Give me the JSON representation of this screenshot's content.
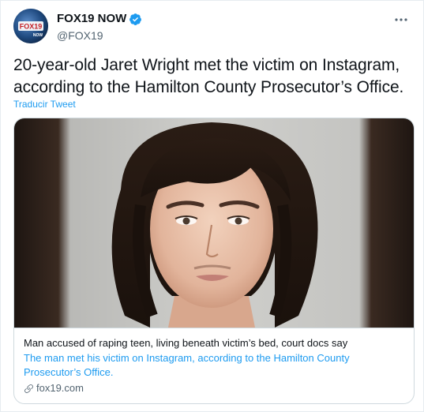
{
  "account": {
    "display_name": "FOX19 NOW",
    "handle": "@FOX19",
    "avatar_logo_text": "FOX19",
    "avatar_logo_subtext": "NOW",
    "verified": true,
    "avatar_icon": "fox19-logo-icon",
    "verified_icon": "verified-badge-icon",
    "more_icon": "more-dots-icon"
  },
  "tweet": {
    "text": "20-year-old Jaret Wright met the victim on Instagram, according to the Hamilton County Prosecutor’s Office.",
    "translate_label": "Traducir Tweet"
  },
  "card": {
    "image_icon": "mugshot-photo",
    "title": "Man accused of raping teen, living beneath victim’s bed, court docs say",
    "description": "The man met his victim on Instagram, according to the Hamilton County Prosecutor’s Office.",
    "domain": "fox19.com",
    "domain_icon": "link-icon"
  },
  "colors": {
    "accent": "#1d9bf0",
    "text_primary": "#0f1419",
    "text_secondary": "#536471",
    "border": "#cfd9de"
  }
}
